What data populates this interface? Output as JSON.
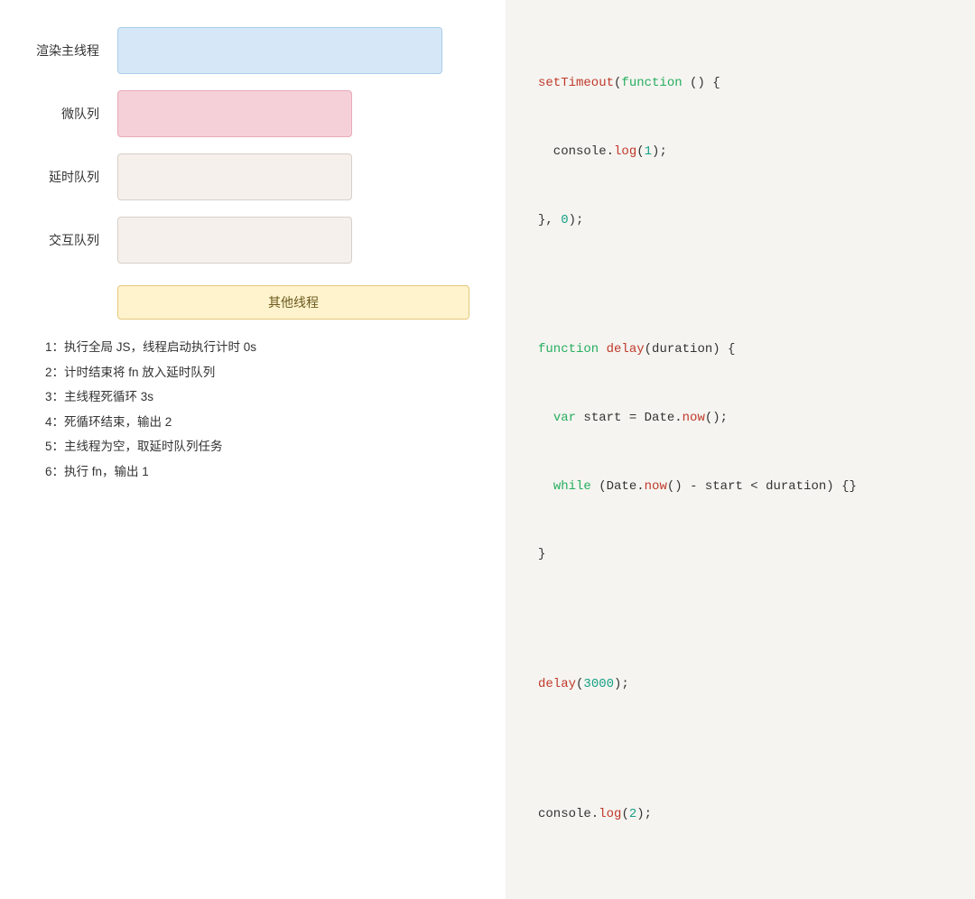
{
  "labels": {
    "main_thread": "渲染主线程",
    "microtask": "微队列",
    "delay_queue": "延时队列",
    "interaction_queue": "交互队列",
    "other_thread": "其他线程"
  },
  "notes": [
    "1：执行全局 JS，线程启动执行计时 0s",
    "2：计时结束将 fn 放入延时队列",
    "3：主线程死循环 3s",
    "4：死循环结束，输出 2",
    "5：主线程为空，取延时队列任务",
    "6：执行 fn，输出 1"
  ],
  "code": {
    "line1": "setTimeout(function () {",
    "line2": "  console.log(1);",
    "line3": "}, 0);",
    "line4": "",
    "line5": "function delay(duration) {",
    "line6": "  var start = Date.now();",
    "line7": "  while (Date.now() - start < duration) {}",
    "line8": "}",
    "line9": "",
    "line10": "delay(3000);",
    "line11": "",
    "line12": "console.log(2);"
  }
}
